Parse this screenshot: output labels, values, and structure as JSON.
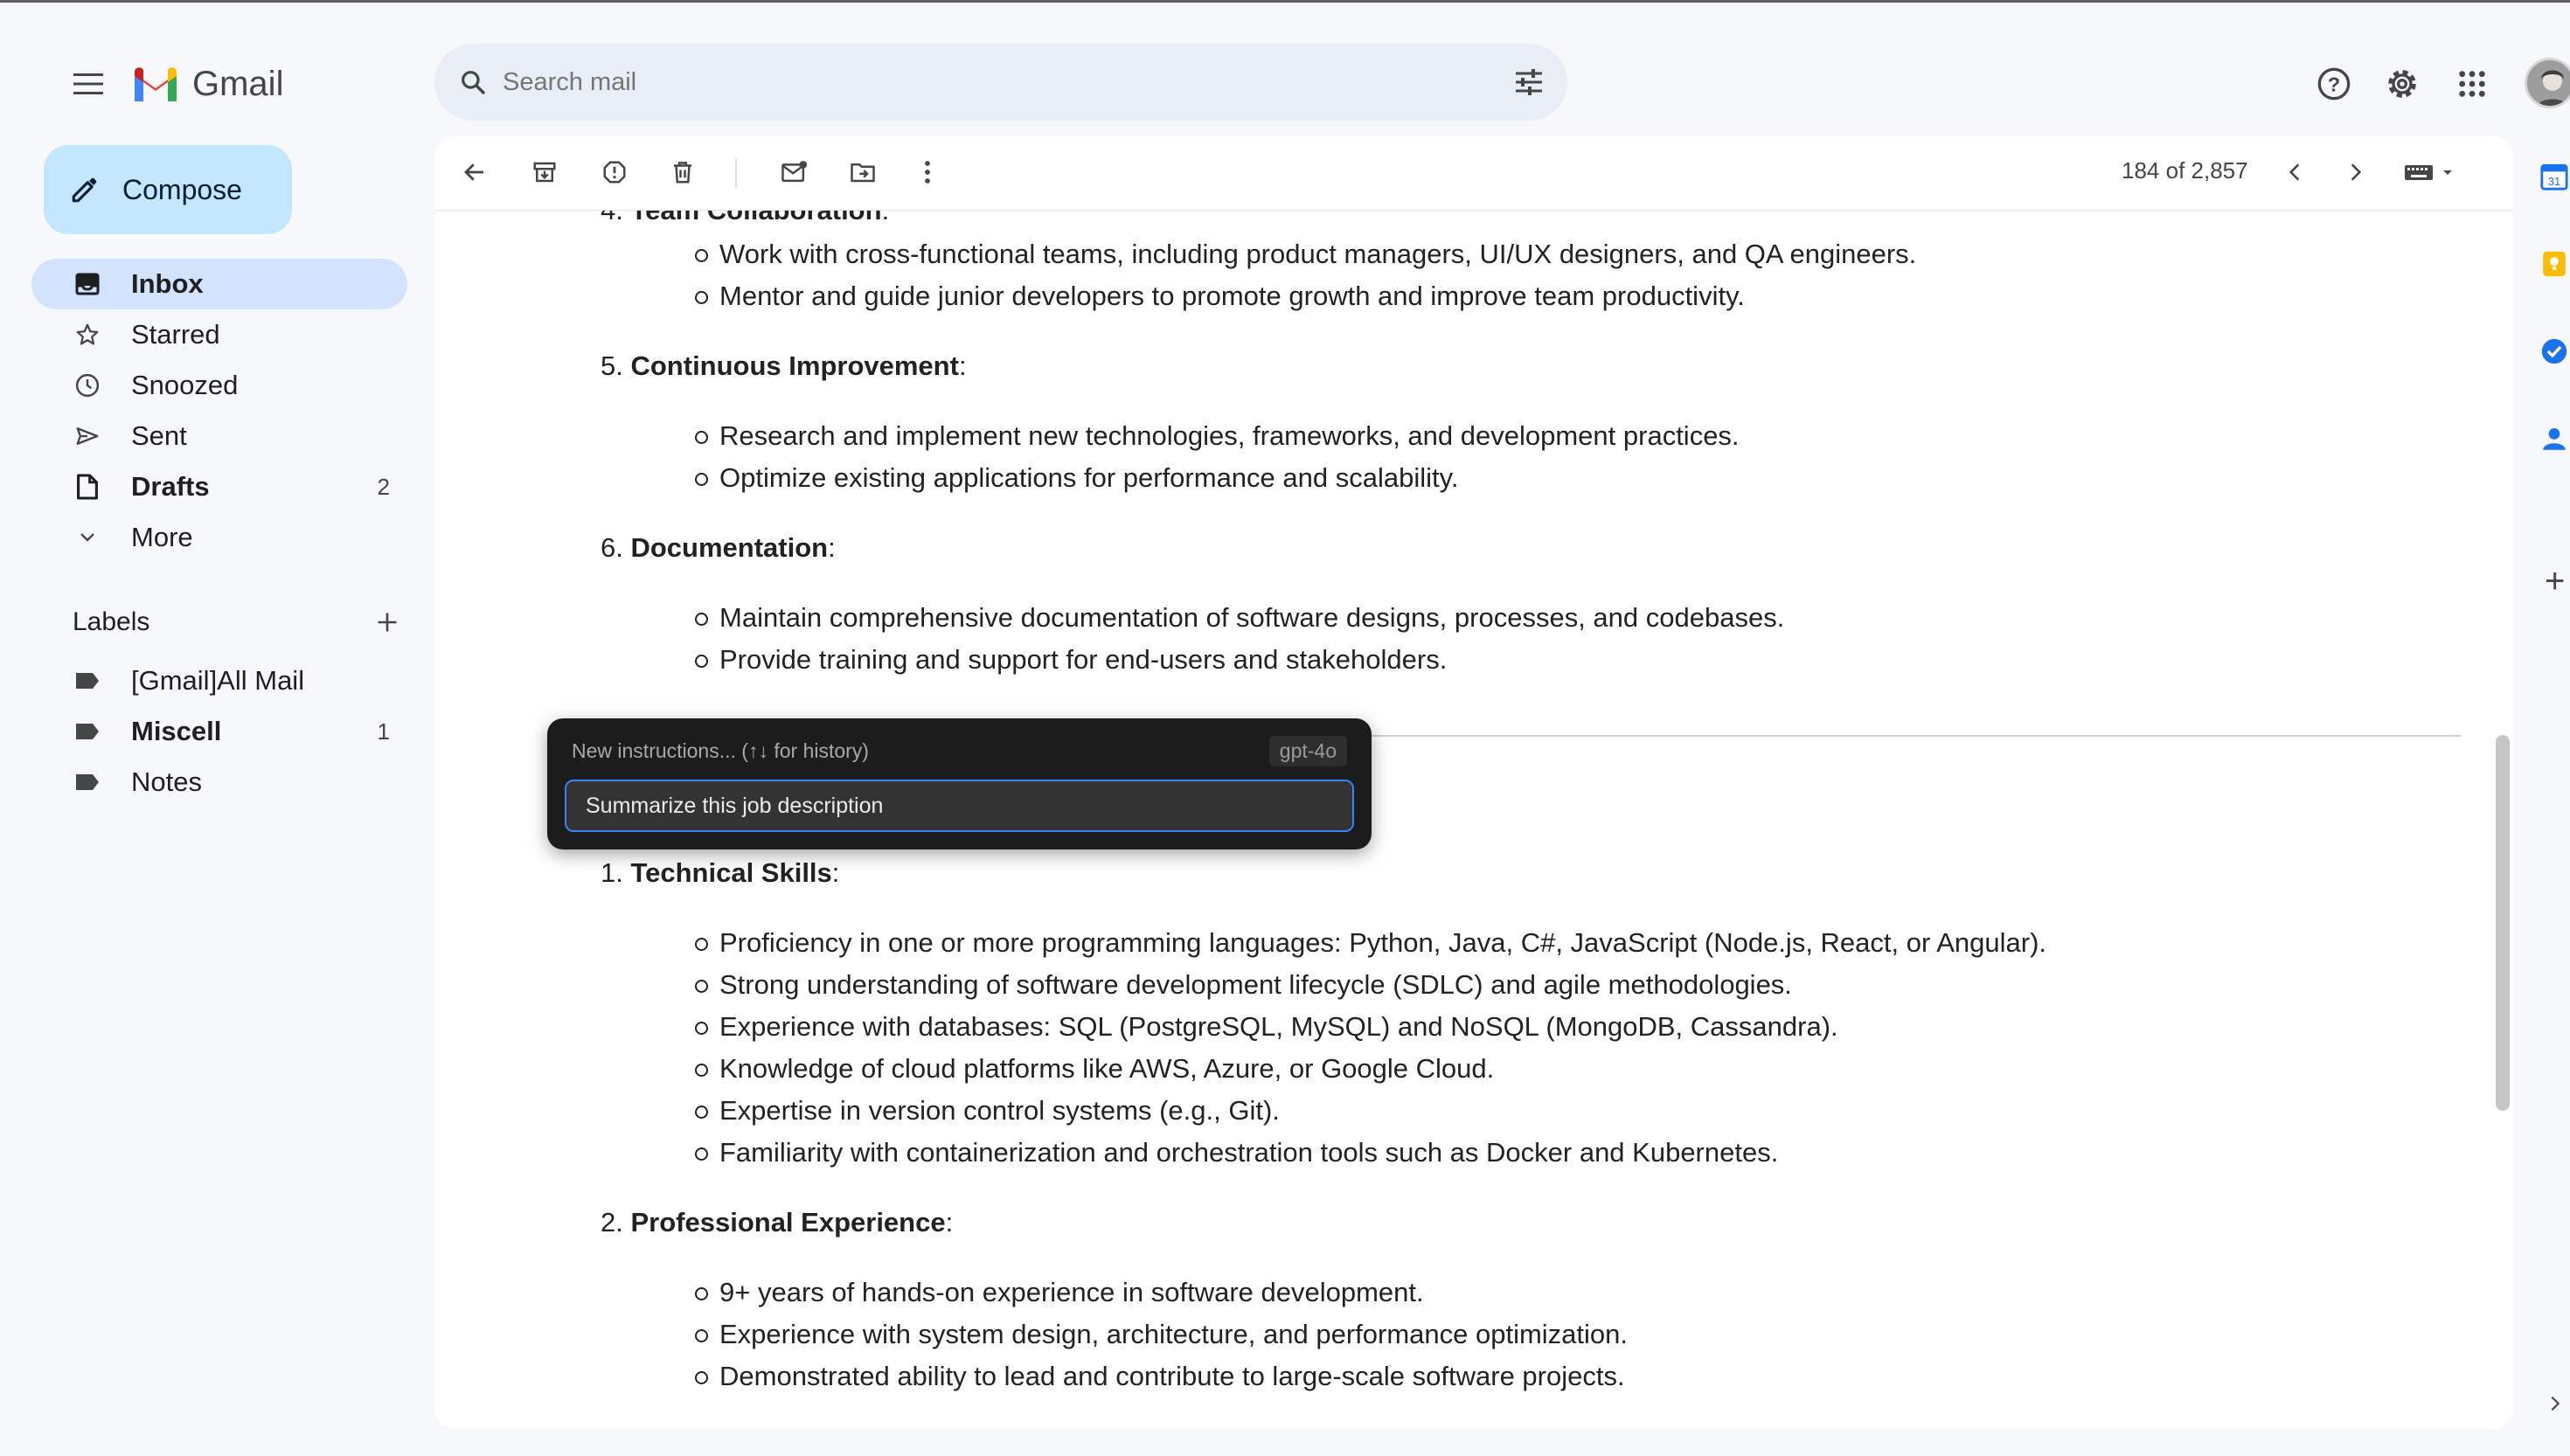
{
  "app": {
    "name": "Gmail"
  },
  "search": {
    "placeholder": "Search mail"
  },
  "compose": {
    "label": "Compose"
  },
  "nav": [
    {
      "label": "Inbox",
      "icon": "inbox-icon",
      "active": true,
      "count": ""
    },
    {
      "label": "Starred",
      "icon": "star-icon",
      "count": ""
    },
    {
      "label": "Snoozed",
      "icon": "clock-icon",
      "count": ""
    },
    {
      "label": "Sent",
      "icon": "send-icon",
      "count": ""
    },
    {
      "label": "Drafts",
      "icon": "draft-icon",
      "count": "2"
    },
    {
      "label": "More",
      "icon": "chevron-down-icon",
      "count": ""
    }
  ],
  "labels_section": {
    "title": "Labels"
  },
  "labels": [
    {
      "label": "[Gmail]All Mail",
      "count": ""
    },
    {
      "label": "Miscell",
      "count": "1"
    },
    {
      "label": "Notes",
      "count": ""
    }
  ],
  "toolbar": {
    "pager": "184 of 2,857"
  },
  "email": {
    "sections": [
      {
        "num": "4.",
        "title": "Team Collaboration",
        "bullets": [
          "Work with cross-functional teams, including product managers, UI/UX designers, and QA engineers.",
          "Mentor and guide junior developers to promote growth and improve team productivity."
        ]
      },
      {
        "num": "5.",
        "title": "Continuous Improvement",
        "bullets": [
          "Research and implement new technologies, frameworks, and development practices.",
          "Optimize existing applications for performance and scalability."
        ]
      },
      {
        "num": "6.",
        "title": "Documentation",
        "bullets": [
          "Maintain comprehensive documentation of software designs, processes, and codebases.",
          "Provide training and support for end-users and stakeholders."
        ]
      },
      {
        "num": "1.",
        "title": "Technical Skills",
        "bullets": [
          "Proficiency in one or more programming languages: Python, Java, C#, JavaScript (Node.js, React, or Angular).",
          "Strong understanding of software development lifecycle (SDLC) and agile methodologies.",
          "Experience with databases: SQL (PostgreSQL, MySQL) and NoSQL (MongoDB, Cassandra).",
          "Knowledge of cloud platforms like AWS, Azure, or Google Cloud.",
          "Expertise in version control systems (e.g., Git).",
          "Familiarity with containerization and orchestration tools such as Docker and Kubernetes."
        ]
      },
      {
        "num": "2.",
        "title": "Professional Experience",
        "bullets": [
          "9+ years of hands-on experience in software development.",
          "Experience with system design, architecture, and performance optimization.",
          "Demonstrated ability to lead and contribute to large-scale software projects."
        ]
      }
    ]
  },
  "overlay": {
    "hint": "New instructions... (↑↓ for history)",
    "model": "gpt-4o",
    "input_value": "Summarize this job description"
  },
  "colors": {
    "accent": "#0b57d0",
    "active_nav": "#d3e3fd",
    "compose": "#c2e7ff"
  }
}
